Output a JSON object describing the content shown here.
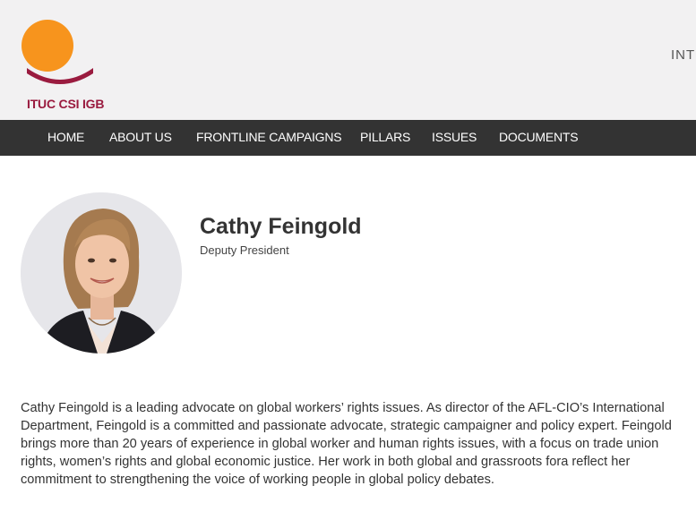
{
  "header": {
    "logo_text": "ITUC CSI IGB",
    "right_link": "INT"
  },
  "colors": {
    "logo_orange": "#f7941d",
    "logo_crimson": "#9a1b3f",
    "nav_background": "#333333",
    "header_background": "#f2f1f2"
  },
  "nav": {
    "items": [
      {
        "label": "HOME"
      },
      {
        "label": "ABOUT US"
      },
      {
        "label": "FRONTLINE CAMPAIGNS"
      },
      {
        "label": "PILLARS"
      },
      {
        "label": "ISSUES"
      },
      {
        "label": "DOCUMENTS"
      }
    ]
  },
  "profile": {
    "name": "Cathy Feingold",
    "title": "Deputy President",
    "bio": "Cathy Feingold is a leading advocate on global workers’ rights issues. As director of the AFL-CIO’s International Department, Feingold is a committed and passionate advocate, strategic campaigner and policy expert. Feingold brings more than 20 years of experience in global worker and human rights issues, with a focus on trade union rights, women’s rights and global economic justice. Her work in both global and grassroots fora reflect her commitment to strengthening the voice of working people in global policy debates."
  }
}
